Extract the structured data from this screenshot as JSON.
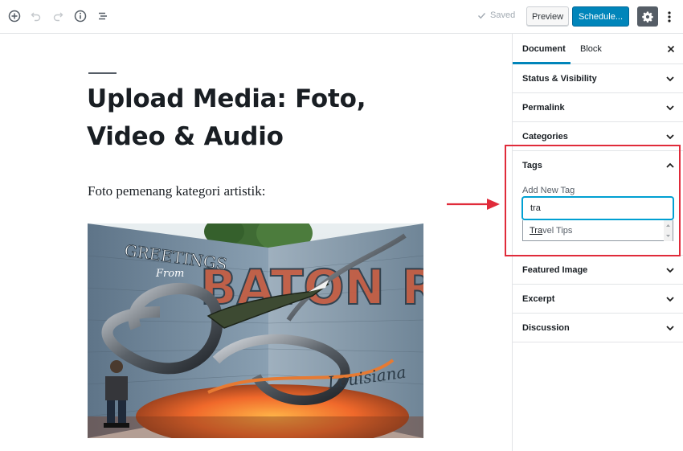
{
  "toolbar": {
    "icons": [
      "add-block-icon",
      "undo-icon",
      "redo-icon",
      "info-icon",
      "list-view-icon"
    ],
    "saved_label": "Saved",
    "preview_label": "Preview",
    "schedule_label": "Schedule...",
    "settings_icon": "gear-icon",
    "more_icon": "more-vertical-icon"
  },
  "editor": {
    "title": "Upload Media: Foto, Video & Audio",
    "paragraph": "Foto pemenang kategori artistik:",
    "image_text": {
      "greetings": "GREETINGS",
      "from": "From",
      "city": "BATON ROUGE",
      "script": "Louisiana"
    }
  },
  "sidebar": {
    "tabs": [
      {
        "label": "Document",
        "active": true
      },
      {
        "label": "Block",
        "active": false
      }
    ],
    "close_icon": "close-icon",
    "panels_top": [
      {
        "title": "Status & Visibility"
      },
      {
        "title": "Permalink"
      },
      {
        "title": "Categories"
      }
    ],
    "tags": {
      "title": "Tags",
      "label": "Add New Tag",
      "input_value": "tra",
      "suggestion_match": "Tra",
      "suggestion_rest": "vel Tips"
    },
    "panels_bottom": [
      {
        "title": "Featured Image"
      },
      {
        "title": "Excerpt"
      },
      {
        "title": "Discussion"
      }
    ]
  },
  "colors": {
    "accent": "#0085ba",
    "annotation": "#e02b3a"
  }
}
